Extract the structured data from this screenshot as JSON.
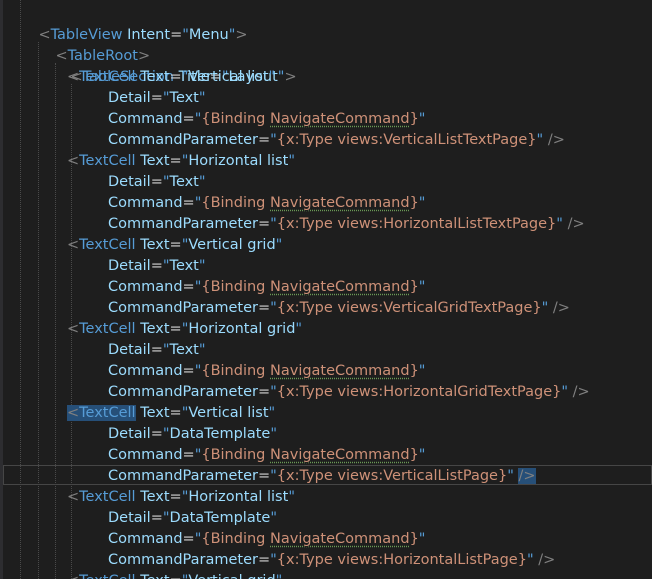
{
  "colors": {
    "background": "#1e1e1e",
    "tag": "#569cd6",
    "attribute": "#9cdcfe",
    "string": "#ce9178",
    "punctuation": "#808080",
    "highlight": "#264f78"
  },
  "code": {
    "table_view": {
      "open_bracket": "<",
      "tag": "TableView",
      "attr": "Intent",
      "value": "Menu",
      "close": ">"
    },
    "table_root": {
      "open_bracket": "<",
      "tag": "TableRoot",
      "close": ">"
    },
    "table_section": {
      "open_bracket": "<",
      "tag": "TableSection",
      "attr": "Title",
      "value": "Layout",
      "close": ">"
    },
    "common": {
      "text_cell_tag": "TextCell",
      "text_attr": "Text",
      "detail_attr": "Detail",
      "command_attr": "Command",
      "command_param_attr": "CommandParameter",
      "binding_open": "{Binding ",
      "binding_name": "NavigateCommand",
      "binding_close": "}",
      "type_prefix": "{x:Type views:",
      "type_close": "}",
      "self_close": "/>",
      "eq": "=",
      "quote": "\"",
      "lt": "<"
    },
    "cells": [
      {
        "text": "Vertical list",
        "detail": "Text",
        "page": "VerticalListTextPage"
      },
      {
        "text": "Horizontal list",
        "detail": "Text",
        "page": "HorizontalListTextPage"
      },
      {
        "text": "Vertical grid",
        "detail": "Text",
        "page": "VerticalGridTextPage"
      },
      {
        "text": "Horizontal grid",
        "detail": "Text",
        "page": "HorizontalGridTextPage"
      },
      {
        "text": "Vertical list",
        "detail": "DataTemplate",
        "page": "VerticalListPage"
      },
      {
        "text": "Horizontal list",
        "detail": "DataTemplate",
        "page": "HorizontalListPage"
      },
      {
        "text": "Vertical grid"
      }
    ]
  }
}
